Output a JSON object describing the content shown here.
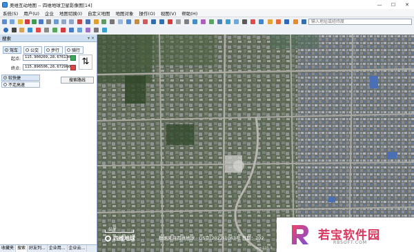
{
  "window": {
    "title": "奥维互动地图 -- 四维地球卫星影像图[14]",
    "buttons": {
      "min": "—",
      "max": "☐",
      "close": "✕"
    }
  },
  "menu": [
    "系统(S)",
    "用户(U)",
    "企业",
    "地图切换(I)",
    "自定义地图",
    "地图对象",
    "操作(O)",
    "视图(V)",
    "帮助(H)"
  ],
  "toolbar": {
    "address_placeholder": "输入地址或经纬度"
  },
  "panel": {
    "title": "搜索",
    "pin": "▾ ✕",
    "modes": [
      {
        "label": "驾车",
        "selected": true
      },
      {
        "label": "公交",
        "selected": false
      },
      {
        "label": "步行",
        "selected": false
      },
      {
        "label": "骑行",
        "selected": false
      }
    ],
    "start_label": "起点:",
    "start_value": "115.900269,28.676130",
    "end_label": "终点:",
    "end_value": "115.896506,28.672960",
    "swap_symbol": "⇅",
    "options": [
      {
        "label": "较快捷",
        "selected": true
      },
      {
        "label": "不走高速",
        "selected": false
      }
    ],
    "search_button": "搜索路线",
    "tabs": [
      "收藏夹",
      "搜索",
      "好友列...",
      "企业用...",
      "企业云..."
    ]
  },
  "map": {
    "scale": "公里",
    "provider": "四维地球",
    "copyright": "数据来自四维地球 · GS京(2022)1063号 日期：202"
  },
  "watermark": {
    "title": "若宝软件园",
    "subtitle": "RBSOFT.COM"
  },
  "status": {
    "coord": "ing:115.9"
  },
  "colors": {
    "panel_header": "#cfdff2",
    "watermark_pink": "#d9375e",
    "accent_blue": "#3a8de0"
  }
}
